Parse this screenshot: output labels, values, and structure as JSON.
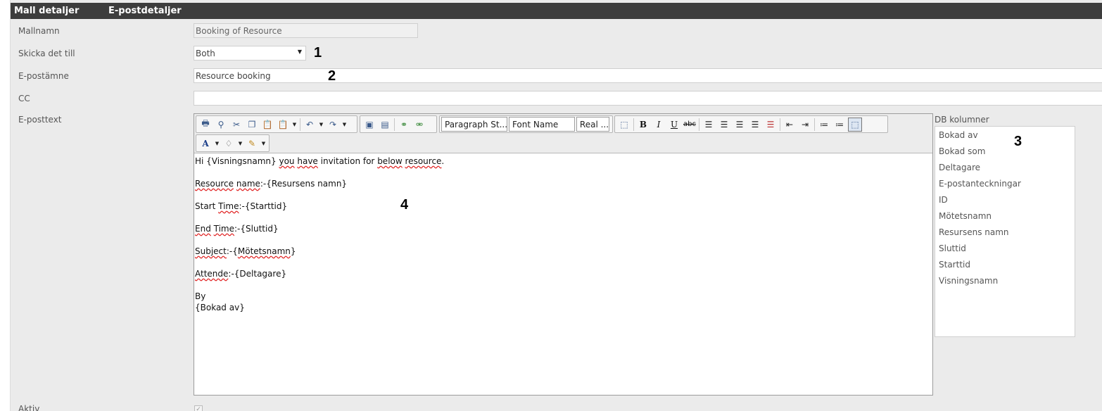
{
  "header": {
    "tab1": "Mall detaljer",
    "tab2": "E-postdetaljer"
  },
  "form": {
    "template_name_label": "Mallnamn",
    "template_name_value": "Booking of Resource",
    "send_to_label": "Skicka det till",
    "send_to_value": "Both",
    "subject_label": "E-postämne",
    "subject_value": "Resource booking",
    "cc_label": "CC",
    "cc_value": "",
    "body_label": "E-posttext",
    "active_label": "Aktiv"
  },
  "annotations": {
    "n1": "1",
    "n2": "2",
    "n3": "3",
    "n4": "4"
  },
  "toolbar": {
    "paragraph_style": "Paragraph St...",
    "font_name": "Font Name",
    "font_size": "Real ..."
  },
  "editor": {
    "line1_a": "Hi {Visningsnamn} ",
    "line1_you": "you",
    "line1_b": " ",
    "line1_have": "have",
    "line1_c": " invitation for ",
    "line1_below": "below",
    "line1_d": " ",
    "line1_resource": "resource",
    "line1_e": ".",
    "line2_a": "Resource",
    "line2_b": " ",
    "line2_name": "name",
    "line2_c": ":-{Resursens namn}",
    "line3_a": "Start ",
    "line3_time": "Time",
    "line3_b": ":-{Starttid}",
    "line4_end": "End",
    "line4_a": " ",
    "line4_time": "Time",
    "line4_b": ":-{Sluttid}",
    "line5_subject": "Subject",
    "line5_a": ":-{",
    "line5_motet": "Mötetsnamn",
    "line5_b": "}",
    "line6_attende": "Attende",
    "line6_a": ":-{Deltagare}",
    "line7": "By",
    "line8": "{Bokad av}"
  },
  "db_columns": {
    "label": "DB kolumner",
    "items": [
      "Bokad av",
      "Bokad som",
      "Deltagare",
      "E-postanteckningar",
      "ID",
      "Mötetsnamn",
      "Resursens namn",
      "Sluttid",
      "Starttid",
      "Visningsnamn"
    ]
  }
}
